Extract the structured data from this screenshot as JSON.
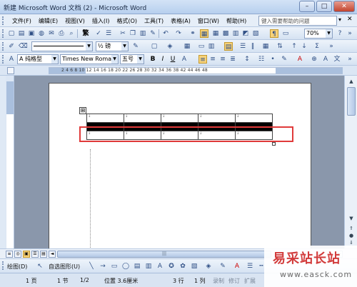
{
  "window": {
    "title": "新建 Microsoft Word 文档 (2) - Microsoft Word",
    "min": "–",
    "max": "□",
    "close": "✕"
  },
  "menu": {
    "items": [
      "文件(F)",
      "编辑(E)",
      "视图(V)",
      "插入(I)",
      "格式(O)",
      "工具(T)",
      "表格(A)",
      "窗口(W)",
      "帮助(H)"
    ],
    "help_placeholder": "键入需要帮助的问题"
  },
  "toolbar_standard": {
    "table_label": "繁",
    "zoom": "70%"
  },
  "toolbar_tables": {
    "line_width": "½ 磅"
  },
  "toolbar_format": {
    "style": "A 纯格型",
    "font": "Times New Roman",
    "size": "五号",
    "bold": "B",
    "italic": "I",
    "underline": "U"
  },
  "ruler": {
    "ticks": "2  4  6  8  10  12  14  16  18  20  22  26  28  30  32  34  36  38  42  44  46  48"
  },
  "document": {
    "anchor": "⊞",
    "table_cell_mark": "↓",
    "rows": 3,
    "cols": 5,
    "selected_row": 2
  },
  "scroll": {
    "hthumb": "|||"
  },
  "drawing": {
    "draw_label": "绘图(D)",
    "autoshape_label": "自选图形(U)"
  },
  "status": {
    "page": "1 页",
    "section": "1 节",
    "page_of": "1/2",
    "position": "位置 3.6厘米",
    "line": "3 行",
    "column": "1 列",
    "rec": "录制",
    "trk": "修订",
    "ext": "扩展"
  },
  "watermark": {
    "title": "易采站长站",
    "url": "www.easck.com"
  }
}
